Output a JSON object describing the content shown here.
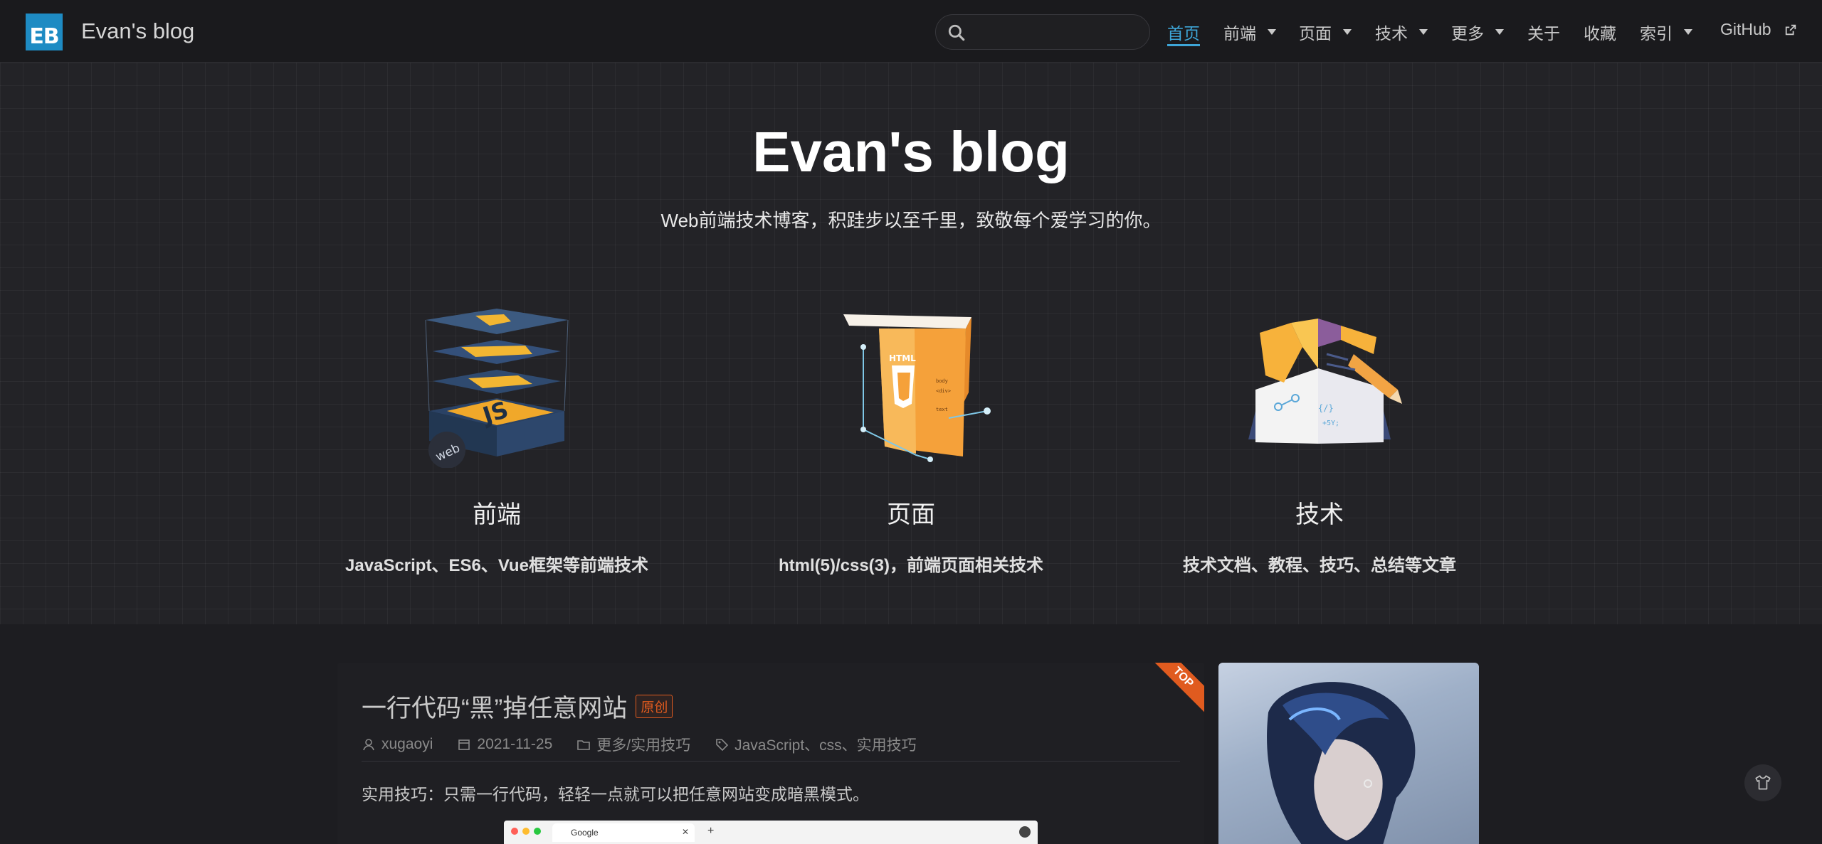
{
  "site": {
    "logo_text": "EB",
    "title": "Evan's blog"
  },
  "search": {
    "placeholder": ""
  },
  "nav": [
    {
      "label": "首页",
      "active": true,
      "dropdown": false
    },
    {
      "label": "前端",
      "active": false,
      "dropdown": true
    },
    {
      "label": "页面",
      "active": false,
      "dropdown": true
    },
    {
      "label": "技术",
      "active": false,
      "dropdown": true
    },
    {
      "label": "更多",
      "active": false,
      "dropdown": true
    },
    {
      "label": "关于",
      "active": false,
      "dropdown": false
    },
    {
      "label": "收藏",
      "active": false,
      "dropdown": false
    },
    {
      "label": "索引",
      "active": false,
      "dropdown": true
    },
    {
      "label": "GitHub",
      "active": false,
      "dropdown": false,
      "external": true
    }
  ],
  "hero": {
    "title": "Evan's blog",
    "description": "Web前端技术博客，积跬步以至千里，致敬每个爱学习的你。",
    "features": [
      {
        "icon": "js-layers-icon",
        "title": "前端",
        "desc": "JavaScript、ES6、Vue框架等前端技术"
      },
      {
        "icon": "html5-page-icon",
        "title": "页面",
        "desc": "html(5)/css(3)，前端页面相关技术"
      },
      {
        "icon": "open-book-icon",
        "title": "技术",
        "desc": "技术文档、教程、技巧、总结等文章"
      }
    ]
  },
  "post": {
    "ribbon": "TOP",
    "title": "一行代码“黑”掉任意网站",
    "badge": "原创",
    "author": "xugaoyi",
    "date": "2021-11-25",
    "category": "更多/实用技巧",
    "tags": "JavaScript、css、实用技巧",
    "excerpt": "实用技巧：只需一行代码，轻轻一点就可以把任意网站变成暗黑模式。",
    "image_tab_label": "Google"
  },
  "colors": {
    "accent": "#3ea6d8",
    "logo": "#1e8bc3",
    "ribbon": "#e05b1f"
  }
}
